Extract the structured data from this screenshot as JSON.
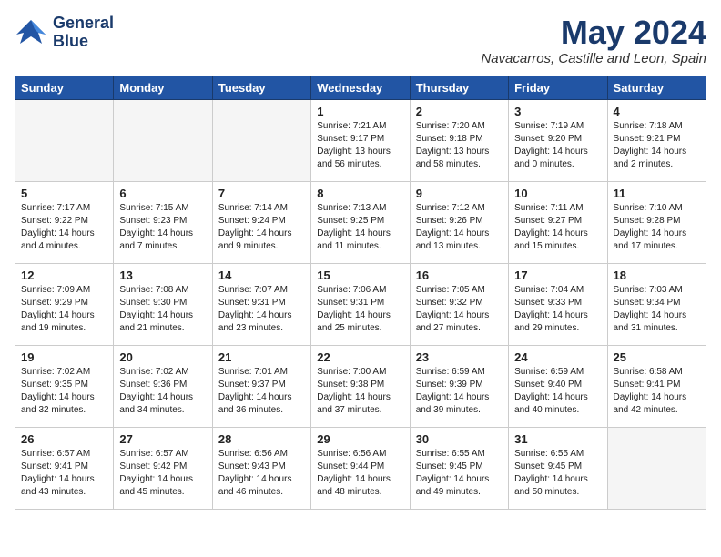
{
  "header": {
    "logo_line1": "General",
    "logo_line2": "Blue",
    "month_year": "May 2024",
    "location": "Navacarros, Castille and Leon, Spain"
  },
  "days_of_week": [
    "Sunday",
    "Monday",
    "Tuesday",
    "Wednesday",
    "Thursday",
    "Friday",
    "Saturday"
  ],
  "weeks": [
    [
      {
        "day": "",
        "content": ""
      },
      {
        "day": "",
        "content": ""
      },
      {
        "day": "",
        "content": ""
      },
      {
        "day": "1",
        "content": "Sunrise: 7:21 AM\nSunset: 9:17 PM\nDaylight: 13 hours\nand 56 minutes."
      },
      {
        "day": "2",
        "content": "Sunrise: 7:20 AM\nSunset: 9:18 PM\nDaylight: 13 hours\nand 58 minutes."
      },
      {
        "day": "3",
        "content": "Sunrise: 7:19 AM\nSunset: 9:20 PM\nDaylight: 14 hours\nand 0 minutes."
      },
      {
        "day": "4",
        "content": "Sunrise: 7:18 AM\nSunset: 9:21 PM\nDaylight: 14 hours\nand 2 minutes."
      }
    ],
    [
      {
        "day": "5",
        "content": "Sunrise: 7:17 AM\nSunset: 9:22 PM\nDaylight: 14 hours\nand 4 minutes."
      },
      {
        "day": "6",
        "content": "Sunrise: 7:15 AM\nSunset: 9:23 PM\nDaylight: 14 hours\nand 7 minutes."
      },
      {
        "day": "7",
        "content": "Sunrise: 7:14 AM\nSunset: 9:24 PM\nDaylight: 14 hours\nand 9 minutes."
      },
      {
        "day": "8",
        "content": "Sunrise: 7:13 AM\nSunset: 9:25 PM\nDaylight: 14 hours\nand 11 minutes."
      },
      {
        "day": "9",
        "content": "Sunrise: 7:12 AM\nSunset: 9:26 PM\nDaylight: 14 hours\nand 13 minutes."
      },
      {
        "day": "10",
        "content": "Sunrise: 7:11 AM\nSunset: 9:27 PM\nDaylight: 14 hours\nand 15 minutes."
      },
      {
        "day": "11",
        "content": "Sunrise: 7:10 AM\nSunset: 9:28 PM\nDaylight: 14 hours\nand 17 minutes."
      }
    ],
    [
      {
        "day": "12",
        "content": "Sunrise: 7:09 AM\nSunset: 9:29 PM\nDaylight: 14 hours\nand 19 minutes."
      },
      {
        "day": "13",
        "content": "Sunrise: 7:08 AM\nSunset: 9:30 PM\nDaylight: 14 hours\nand 21 minutes."
      },
      {
        "day": "14",
        "content": "Sunrise: 7:07 AM\nSunset: 9:31 PM\nDaylight: 14 hours\nand 23 minutes."
      },
      {
        "day": "15",
        "content": "Sunrise: 7:06 AM\nSunset: 9:31 PM\nDaylight: 14 hours\nand 25 minutes."
      },
      {
        "day": "16",
        "content": "Sunrise: 7:05 AM\nSunset: 9:32 PM\nDaylight: 14 hours\nand 27 minutes."
      },
      {
        "day": "17",
        "content": "Sunrise: 7:04 AM\nSunset: 9:33 PM\nDaylight: 14 hours\nand 29 minutes."
      },
      {
        "day": "18",
        "content": "Sunrise: 7:03 AM\nSunset: 9:34 PM\nDaylight: 14 hours\nand 31 minutes."
      }
    ],
    [
      {
        "day": "19",
        "content": "Sunrise: 7:02 AM\nSunset: 9:35 PM\nDaylight: 14 hours\nand 32 minutes."
      },
      {
        "day": "20",
        "content": "Sunrise: 7:02 AM\nSunset: 9:36 PM\nDaylight: 14 hours\nand 34 minutes."
      },
      {
        "day": "21",
        "content": "Sunrise: 7:01 AM\nSunset: 9:37 PM\nDaylight: 14 hours\nand 36 minutes."
      },
      {
        "day": "22",
        "content": "Sunrise: 7:00 AM\nSunset: 9:38 PM\nDaylight: 14 hours\nand 37 minutes."
      },
      {
        "day": "23",
        "content": "Sunrise: 6:59 AM\nSunset: 9:39 PM\nDaylight: 14 hours\nand 39 minutes."
      },
      {
        "day": "24",
        "content": "Sunrise: 6:59 AM\nSunset: 9:40 PM\nDaylight: 14 hours\nand 40 minutes."
      },
      {
        "day": "25",
        "content": "Sunrise: 6:58 AM\nSunset: 9:41 PM\nDaylight: 14 hours\nand 42 minutes."
      }
    ],
    [
      {
        "day": "26",
        "content": "Sunrise: 6:57 AM\nSunset: 9:41 PM\nDaylight: 14 hours\nand 43 minutes."
      },
      {
        "day": "27",
        "content": "Sunrise: 6:57 AM\nSunset: 9:42 PM\nDaylight: 14 hours\nand 45 minutes."
      },
      {
        "day": "28",
        "content": "Sunrise: 6:56 AM\nSunset: 9:43 PM\nDaylight: 14 hours\nand 46 minutes."
      },
      {
        "day": "29",
        "content": "Sunrise: 6:56 AM\nSunset: 9:44 PM\nDaylight: 14 hours\nand 48 minutes."
      },
      {
        "day": "30",
        "content": "Sunrise: 6:55 AM\nSunset: 9:45 PM\nDaylight: 14 hours\nand 49 minutes."
      },
      {
        "day": "31",
        "content": "Sunrise: 6:55 AM\nSunset: 9:45 PM\nDaylight: 14 hours\nand 50 minutes."
      },
      {
        "day": "",
        "content": ""
      }
    ]
  ]
}
